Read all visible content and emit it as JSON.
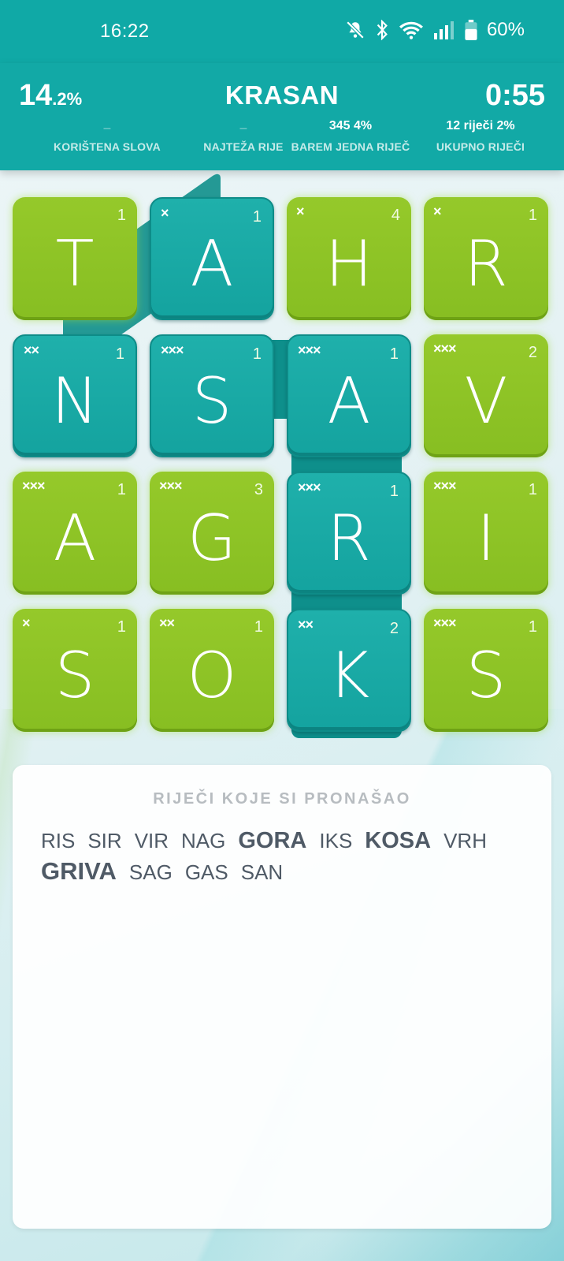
{
  "status": {
    "time": "16:22",
    "battery": "60%",
    "icons": [
      "bell-off-icon",
      "bluetooth-icon",
      "wifi-icon",
      "signal-icon",
      "battery-icon"
    ]
  },
  "header": {
    "percent_big": "14",
    "percent_small": ".2%",
    "title": "KRASAN",
    "timer": "0:55",
    "stats": [
      {
        "value": "–",
        "label": "KORIŠTENA SLOVA"
      },
      {
        "value": "–",
        "label": "NAJTEŽA RIJE"
      },
      {
        "value": "345  4%",
        "label": "BAREM JEDNA RIJEČ"
      },
      {
        "value": "12 riječi  2%",
        "label": "UKUPNO RIJEČI"
      }
    ]
  },
  "board": {
    "tiles": [
      {
        "letter": "T",
        "num": "1",
        "marks": "",
        "state": "green"
      },
      {
        "letter": "A",
        "num": "1",
        "marks": "×",
        "state": "teal"
      },
      {
        "letter": "H",
        "num": "4",
        "marks": "×",
        "state": "green"
      },
      {
        "letter": "R",
        "num": "1",
        "marks": "×",
        "state": "green"
      },
      {
        "letter": "N",
        "num": "1",
        "marks": "××",
        "state": "teal"
      },
      {
        "letter": "S",
        "num": "1",
        "marks": "×××",
        "state": "teal"
      },
      {
        "letter": "A",
        "num": "1",
        "marks": "×××",
        "state": "teal"
      },
      {
        "letter": "V",
        "num": "2",
        "marks": "×××",
        "state": "green"
      },
      {
        "letter": "A",
        "num": "1",
        "marks": "×××",
        "state": "green"
      },
      {
        "letter": "G",
        "num": "3",
        "marks": "×××",
        "state": "green"
      },
      {
        "letter": "R",
        "num": "1",
        "marks": "×××",
        "state": "teal"
      },
      {
        "letter": "I",
        "num": "1",
        "marks": "×××",
        "state": "green"
      },
      {
        "letter": "S",
        "num": "1",
        "marks": "×",
        "state": "green"
      },
      {
        "letter": "O",
        "num": "1",
        "marks": "××",
        "state": "green"
      },
      {
        "letter": "K",
        "num": "2",
        "marks": "××",
        "state": "teal"
      },
      {
        "letter": "S",
        "num": "1",
        "marks": "×××",
        "state": "green"
      }
    ]
  },
  "found": {
    "title": "RIJEČI KOJE SI PRONAŠAO",
    "words": [
      "RIS",
      "SIR",
      "VIR",
      "NAG",
      "GORA",
      "IKS",
      "KOSA",
      "VRH",
      "GRIVA",
      "SAG",
      "GAS",
      "SAN"
    ]
  },
  "colors": {
    "header": "#12a9a6",
    "tile_green": "#8cc227",
    "tile_teal": "#17a7a3",
    "path": "#0e8f8b",
    "word_text": "#4f5a66"
  }
}
